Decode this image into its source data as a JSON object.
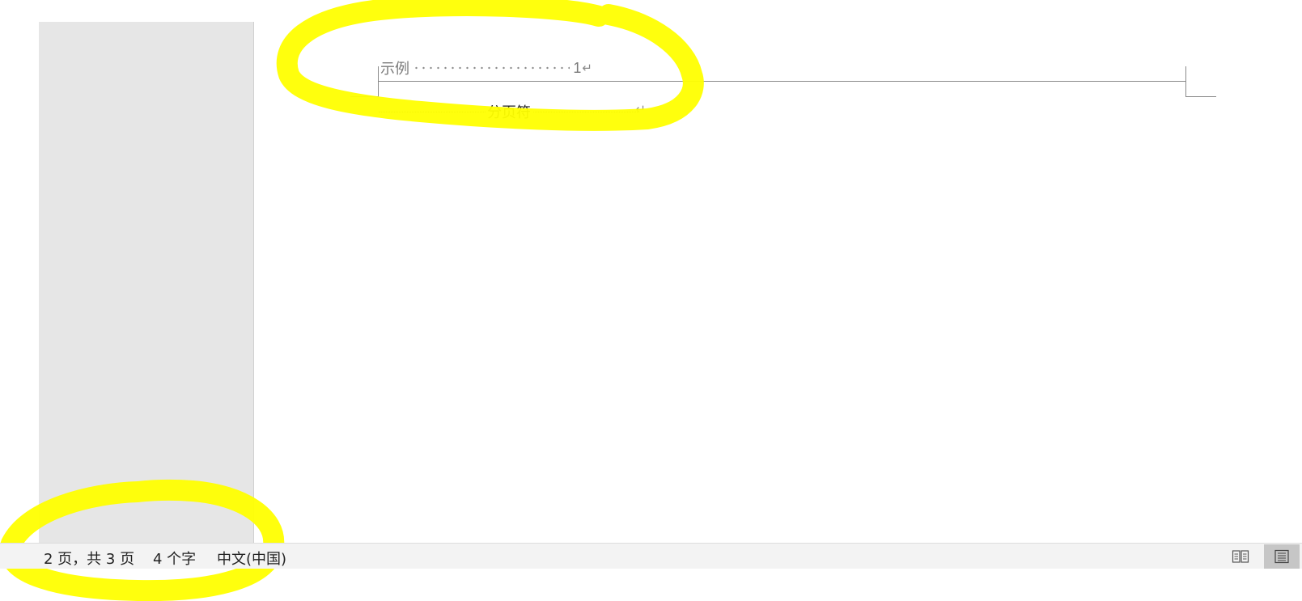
{
  "document": {
    "toc_entry": {
      "text": "示例",
      "page": "1",
      "paragraph_mark": "↵"
    },
    "page_break": {
      "label": "分页符",
      "paragraph_mark": "↵"
    }
  },
  "status_bar": {
    "page_info": "2 页，共 3 页",
    "word_count": "4 个字",
    "language": "中文(中国)",
    "view_buttons": [
      {
        "icon": "read-mode-icon",
        "active": false
      },
      {
        "icon": "print-layout-icon",
        "active": true
      }
    ]
  },
  "annotations": {
    "highlight_color": "#ffff00"
  }
}
